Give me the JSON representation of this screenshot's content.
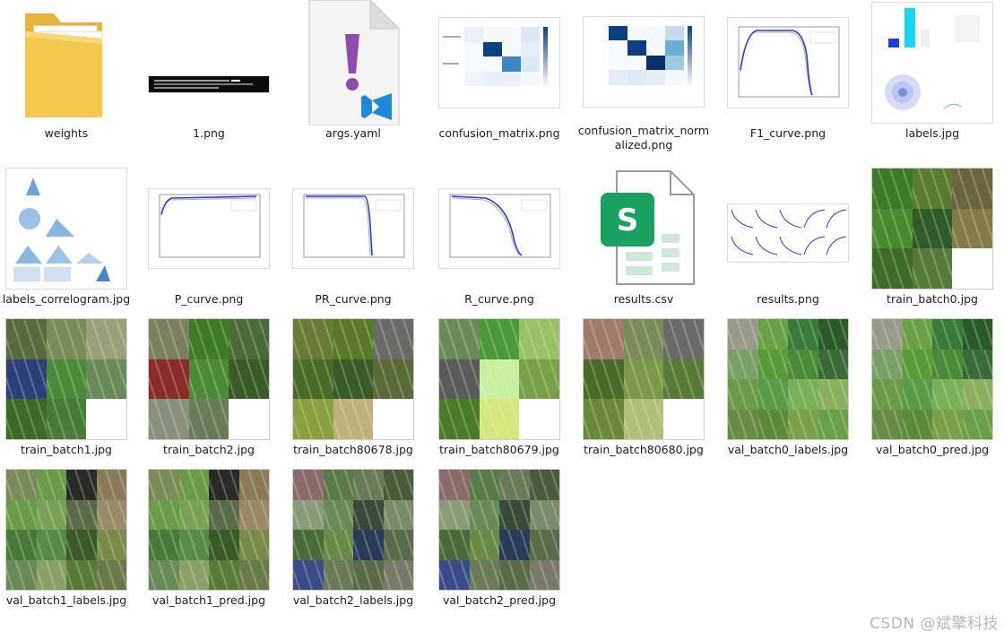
{
  "files": [
    {
      "name": "weights",
      "kind": "folder"
    },
    {
      "name": "1.png",
      "kind": "terminal"
    },
    {
      "name": "args.yaml",
      "kind": "yaml"
    },
    {
      "name": "confusion_matrix.png",
      "kind": "confusion"
    },
    {
      "name": "confusion_matrix_normalized.png",
      "kind": "confusion_norm"
    },
    {
      "name": "F1_curve.png",
      "kind": "curve_down"
    },
    {
      "name": "labels.jpg",
      "kind": "labels"
    },
    {
      "name": "labels_correlogram.jpg",
      "kind": "correlogram"
    },
    {
      "name": "P_curve.png",
      "kind": "curve_up"
    },
    {
      "name": "PR_curve.png",
      "kind": "curve_pr"
    },
    {
      "name": "R_curve.png",
      "kind": "curve_down"
    },
    {
      "name": "results.csv",
      "kind": "csv"
    },
    {
      "name": "results.png",
      "kind": "results"
    },
    {
      "name": "train_batch0.jpg",
      "kind": "batch"
    },
    {
      "name": "train_batch1.jpg",
      "kind": "batch"
    },
    {
      "name": "train_batch2.jpg",
      "kind": "batch"
    },
    {
      "name": "train_batch80678.jpg",
      "kind": "batch"
    },
    {
      "name": "train_batch80679.jpg",
      "kind": "batch"
    },
    {
      "name": "train_batch80680.jpg",
      "kind": "batch"
    },
    {
      "name": "val_batch0_labels.jpg",
      "kind": "val"
    },
    {
      "name": "val_batch0_pred.jpg",
      "kind": "val"
    },
    {
      "name": "val_batch1_labels.jpg",
      "kind": "val"
    },
    {
      "name": "val_batch1_pred.jpg",
      "kind": "val"
    },
    {
      "name": "val_batch2_labels.jpg",
      "kind": "val"
    },
    {
      "name": "val_batch2_pred.jpg",
      "kind": "val"
    }
  ],
  "watermark": "CSDN @斌擎科技",
  "colors": {
    "folder": "#f4c84f",
    "yaml_accent": "#8e4bb0",
    "vscode_blue": "#1f88d8",
    "csv_green": "#1aa060",
    "curve_blue": "#2b3bd0",
    "cmap_dark": "#0c3f83"
  }
}
